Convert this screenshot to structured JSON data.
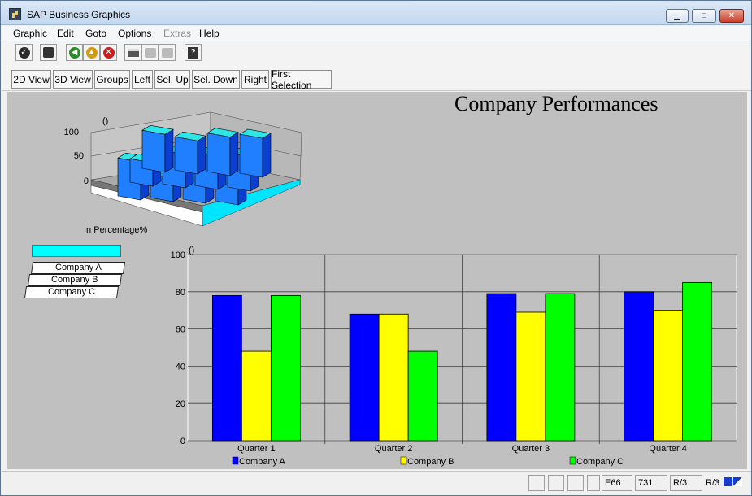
{
  "window": {
    "title": "SAP Business Graphics",
    "minimize_glyph": "▁",
    "maximize_glyph": "□",
    "close_glyph": "✕"
  },
  "menu": [
    "Graphic",
    "Edit",
    "Goto",
    "Options",
    "Extras",
    "Help"
  ],
  "menu_disabled": [
    "Extras"
  ],
  "toolbar_icons": [
    "check-icon",
    "save-icon",
    "back-icon",
    "exit-icon",
    "cancel-icon",
    "print-icon",
    "find-icon",
    "find-next-icon",
    "help-icon"
  ],
  "view_buttons": [
    "2D View",
    "3D View",
    "Groups",
    "Left",
    "Sel. Up",
    "Sel. Down",
    "Right",
    "First Selection"
  ],
  "graphic": {
    "title": "Company Performances",
    "overview_axis_label": "In Percentage%",
    "overview_unit": "()",
    "overview_ticks": [
      "100",
      "50",
      "0"
    ],
    "legend": [
      "Company A",
      "Company B",
      "Company C"
    ]
  },
  "chart_data": {
    "type": "bar",
    "categories": [
      "Quarter 1",
      "Quarter 2",
      "Quarter 3",
      "Quarter 4"
    ],
    "series": [
      {
        "name": "Company A",
        "color": "#0000ff",
        "values": [
          78,
          68,
          79,
          80
        ]
      },
      {
        "name": "Company B",
        "color": "#ffff00",
        "values": [
          48,
          68,
          69,
          70
        ]
      },
      {
        "name": "Company C",
        "color": "#00ff00",
        "values": [
          78,
          48,
          79,
          85
        ]
      }
    ],
    "ylabel": "()",
    "ylim": [
      0,
      100
    ],
    "yticks": [
      0,
      20,
      40,
      60,
      80,
      100
    ],
    "grid": true,
    "legend_position": "bottom"
  },
  "status": {
    "system": "E66",
    "client": "731",
    "release": "R/3",
    "release_icon": "R/3"
  }
}
